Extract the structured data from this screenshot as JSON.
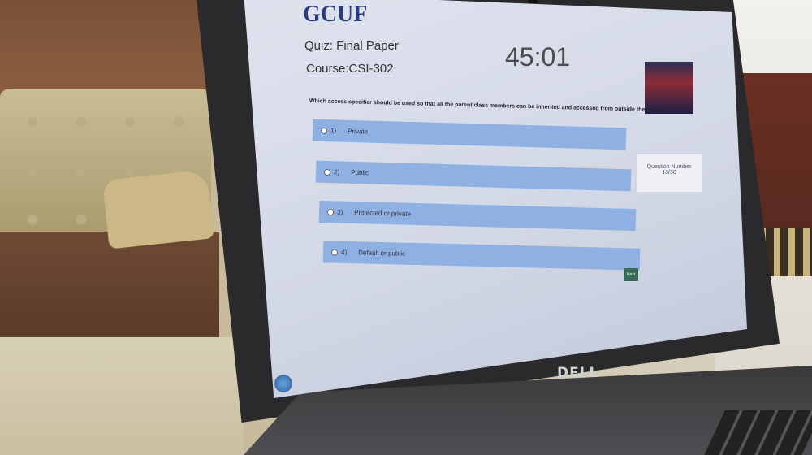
{
  "exam": {
    "logo_text": "GCUF",
    "quiz_title": "Quiz: Final Paper",
    "course": "Course:CSI-302",
    "timer": "45:01",
    "question": "Which access specifier should be used so that all the parent class members can be inherited and accessed from outside the class?",
    "options": [
      {
        "num": "1)",
        "label": "Private"
      },
      {
        "num": "2)",
        "label": "Public"
      },
      {
        "num": "3)",
        "label": "Protected or private"
      },
      {
        "num": "4)",
        "label": "Default or public"
      }
    ],
    "question_number_label": "Question Number",
    "question_number_value": "13/30",
    "next_label": "Next"
  },
  "laptop": {
    "brand": "DELL"
  }
}
